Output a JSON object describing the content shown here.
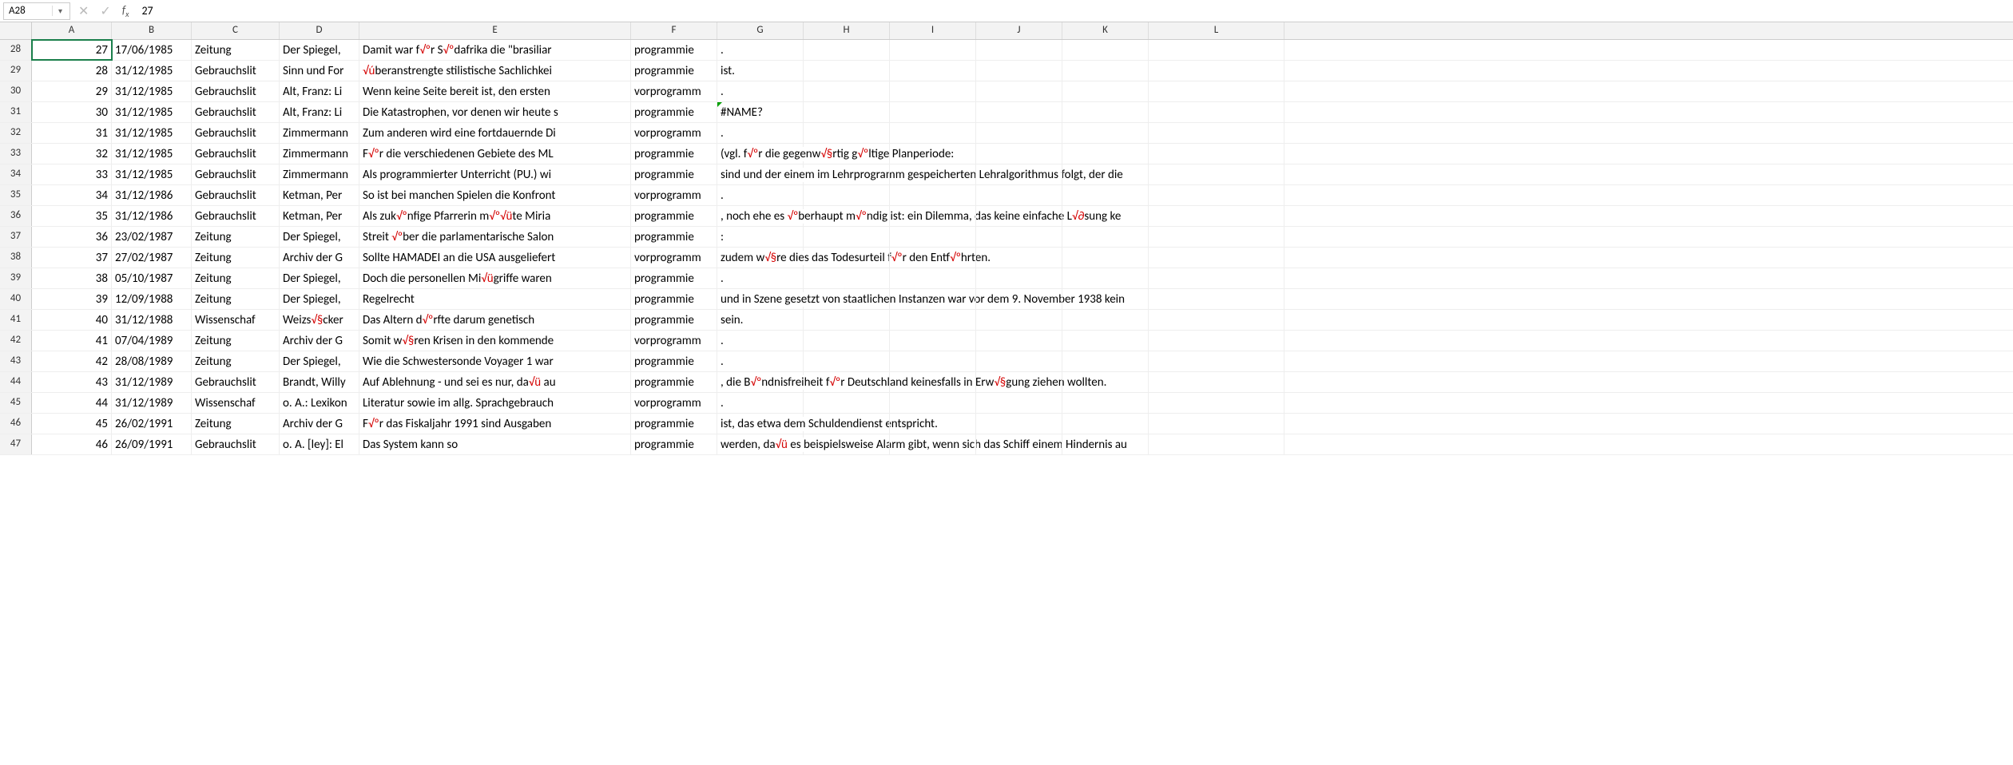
{
  "nameBox": "A28",
  "formulaValue": "27",
  "fxLabel": "fx",
  "columns": [
    "A",
    "B",
    "C",
    "D",
    "E",
    "F",
    "G",
    "H",
    "I",
    "J",
    "K",
    "L"
  ],
  "colWidths": [
    "wA",
    "wB",
    "wC",
    "wD",
    "wE",
    "wF",
    "wG",
    "wH",
    "wI",
    "wJ",
    "wK",
    "wL"
  ],
  "rows": [
    {
      "n": 28,
      "A": "27",
      "B": "17/06/1985",
      "C": "Zeitung",
      "D": "Der Spiegel,",
      "E": "Damit war f√ºr S√ºdafrika die \"brasiliar",
      "F": "programmie",
      "G": "."
    },
    {
      "n": 29,
      "A": "28",
      "B": "31/12/1985",
      "C": "Gebrauchslit",
      "D": "Sinn und For",
      "E": "√úberanstrengte stilistische Sachlichkei",
      "F": "programmie",
      "G": "ist."
    },
    {
      "n": 30,
      "A": "29",
      "B": "31/12/1985",
      "C": "Gebrauchslit",
      "D": "Alt, Franz: Li",
      "E": "Wenn keine Seite bereit ist, den ersten",
      "F": "vorprogramm",
      "G": "."
    },
    {
      "n": 31,
      "A": "30",
      "B": "31/12/1985",
      "C": "Gebrauchslit",
      "D": "Alt, Franz: Li",
      "E": "Die Katastrophen, vor denen wir heute s",
      "F": "programmie",
      "G": "#NAME?",
      "err": true
    },
    {
      "n": 32,
      "A": "31",
      "B": "31/12/1985",
      "C": "Gebrauchslit",
      "D": "Zimmermann",
      "E": "Zum anderen wird eine fortdauernde Di",
      "F": "vorprogramm",
      "G": "."
    },
    {
      "n": 33,
      "A": "32",
      "B": "31/12/1985",
      "C": "Gebrauchslit",
      "D": "Zimmermann",
      "E": "F√ºr die verschiedenen Gebiete des ML",
      "F": "programmie",
      "G": "(vgl. f√ºr die gegenw√§rtig g√ºltige Planperiode:"
    },
    {
      "n": 34,
      "A": "33",
      "B": "31/12/1985",
      "C": "Gebrauchslit",
      "D": "Zimmermann",
      "E": "Als programmierter Unterricht (PU.) wi",
      "F": "programmie",
      "G": "sind und der einem im Lehrprogramm gespeicherten Lehralgorithmus folgt, der die"
    },
    {
      "n": 35,
      "A": "34",
      "B": "31/12/1986",
      "C": "Gebrauchslit",
      "D": "Ketman, Per",
      "E": "So ist bei manchen Spielen die Konfront",
      "F": "vorprogramm",
      "G": "."
    },
    {
      "n": 36,
      "A": "35",
      "B": "31/12/1986",
      "C": "Gebrauchslit",
      "D": "Ketman, Per",
      "E": "Als zuk√ºnfige Pfarrerin m√º√üte Miria",
      "F": "programmie",
      "G": ", noch ehe es √ºberhaupt m√ºndig ist: ein Dilemma, das keine einfache L√∂sung ke"
    },
    {
      "n": 37,
      "A": "36",
      "B": "23/02/1987",
      "C": "Zeitung",
      "D": "Der Spiegel,",
      "E": "Streit √ºber die parlamentarische Salon",
      "F": "programmie",
      "G": ":"
    },
    {
      "n": 38,
      "A": "37",
      "B": "27/02/1987",
      "C": "Zeitung",
      "D": "Archiv der G",
      "E": "Sollte HAMADEI an die USA ausgeliefert",
      "F": "vorprogramm",
      "G": "zudem w√§re dies das Todesurteil f√ºr den Entf√ºhrten."
    },
    {
      "n": 39,
      "A": "38",
      "B": "05/10/1987",
      "C": "Zeitung",
      "D": "Der Spiegel,",
      "E": "Doch die personellen Mi√ügriffe waren",
      "F": "programmie",
      "G": "."
    },
    {
      "n": 40,
      "A": "39",
      "B": "12/09/1988",
      "C": "Zeitung",
      "D": "Der Spiegel,",
      "E": "Regelrecht",
      "F": "programmie",
      "G": "und in Szene gesetzt von staatlichen Instanzen war vor dem 9. November 1938 kein"
    },
    {
      "n": 41,
      "A": "40",
      "B": "31/12/1988",
      "C": "Wissenschaf",
      "D": "Weizs√§cker",
      "E": "Das Altern d√ºrfte darum genetisch",
      "F": "programmie",
      "G": "sein."
    },
    {
      "n": 42,
      "A": "41",
      "B": "07/04/1989",
      "C": "Zeitung",
      "D": "Archiv der G",
      "E": "Somit w√§ren Krisen in den kommende",
      "F": "vorprogramm",
      "G": "."
    },
    {
      "n": 43,
      "A": "42",
      "B": "28/08/1989",
      "C": "Zeitung",
      "D": "Der Spiegel,",
      "E": "Wie die Schwestersonde Voyager 1 war",
      "F": "programmie",
      "G": "."
    },
    {
      "n": 44,
      "A": "43",
      "B": "31/12/1989",
      "C": "Gebrauchslit",
      "D": "Brandt, Willy",
      "E": "Auf Ablehnung - und sei es nur, da√ü au",
      "F": "programmie",
      "G": ", die B√ºndnisfreiheit f√ºr Deutschland keinesfalls in Erw√§gung ziehen wollten."
    },
    {
      "n": 45,
      "A": "44",
      "B": "31/12/1989",
      "C": "Wissenschaf",
      "D": "o. A.: Lexikon",
      "E": "Literatur sowie im allg. Sprachgebrauch",
      "F": "vorprogramm",
      "G": "."
    },
    {
      "n": 46,
      "A": "45",
      "B": "26/02/1991",
      "C": "Zeitung",
      "D": "Archiv der G",
      "E": "F√ºr das Fiskaljahr 1991 sind Ausgaben",
      "F": "programmie",
      "G": "ist, das etwa dem Schuldendienst entspricht."
    },
    {
      "n": 47,
      "A": "46",
      "B": "26/09/1991",
      "C": "Gebrauchslit",
      "D": "o. A. [ley]: El",
      "E": "Das System kann so",
      "F": "programmie",
      "G": "werden, da√ü es beispielsweise Alarm gibt, wenn sich das Schiff einem Hindernis au"
    }
  ]
}
